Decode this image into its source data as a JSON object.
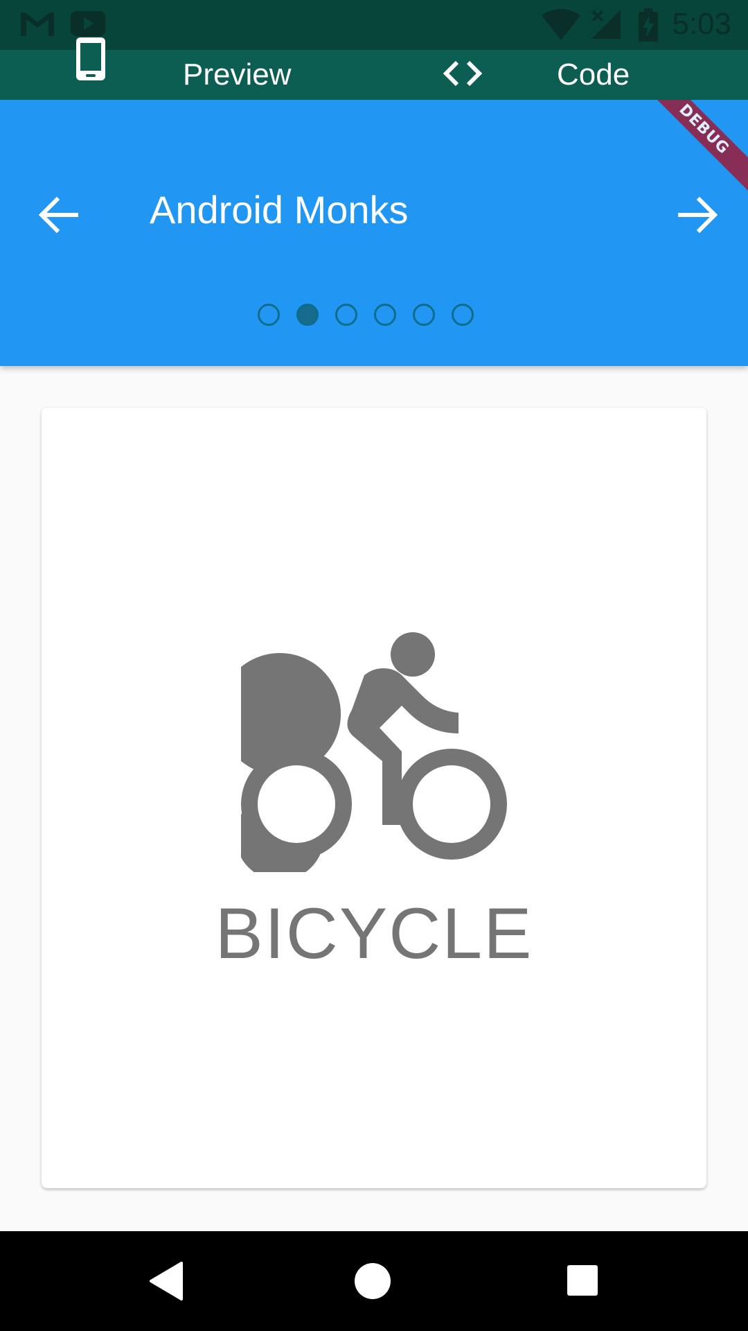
{
  "status_bar": {
    "time": "5:03",
    "icons": [
      "gmail-icon",
      "youtube-icon",
      "wifi-icon",
      "no-signal-icon",
      "battery-charging-icon"
    ]
  },
  "toolbar": {
    "preview_label": "Preview",
    "code_label": "Code",
    "icons": [
      "phone-icon",
      "code-icon"
    ]
  },
  "app_bar": {
    "title": "Android Monks",
    "back_icon": "arrow-back-icon",
    "forward_icon": "arrow-forward-icon",
    "page_count": 6,
    "active_page": 2,
    "debug_label": "DEBUG"
  },
  "card": {
    "icon": "bicycle-icon",
    "label": "BICYCLE"
  },
  "navigation_bar": {
    "icons": [
      "nav-back-icon",
      "nav-home-icon",
      "nav-recents-icon"
    ]
  },
  "colors": {
    "status_bar": "#07453b",
    "toolbar": "#0b5e51",
    "app_bar": "#2196f3",
    "dot_active": "#176b8c",
    "icon_grey": "#757575",
    "debug_banner": "#9b1d3b"
  }
}
